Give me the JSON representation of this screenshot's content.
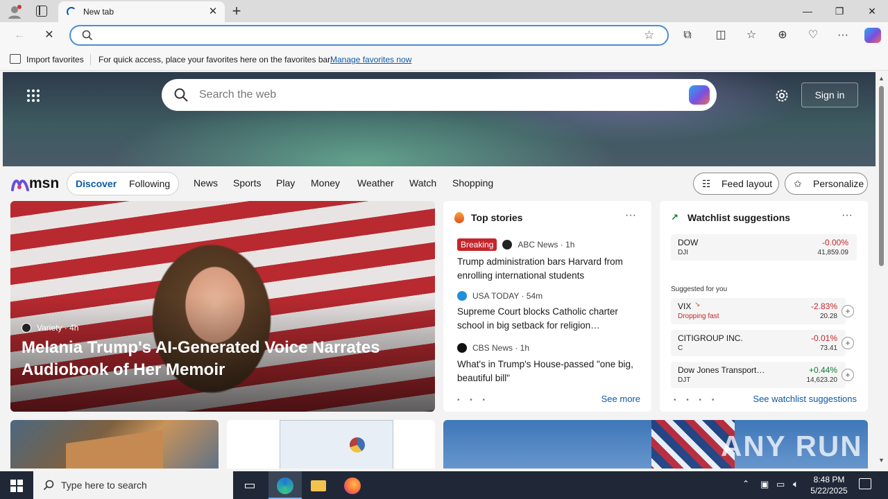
{
  "browser": {
    "tab_title": "New tab",
    "tab_close": "✕",
    "new_tab": "+",
    "window": {
      "minimize": "—",
      "restore": "❐",
      "close": "✕"
    },
    "address_value": "",
    "favorites_bar": {
      "import_label": "Import favorites",
      "hint": "For quick access, place your favorites here on the favorites bar.",
      "manage_link": "Manage favorites now"
    }
  },
  "msn": {
    "search_placeholder": "Search the web",
    "sign_in": "Sign in",
    "logo": "msn",
    "tabs": [
      "Discover",
      "Following"
    ],
    "nav": [
      "News",
      "Sports",
      "Play",
      "Money",
      "Weather",
      "Watch",
      "Shopping"
    ],
    "feed_layout": "Feed layout",
    "personalize": "Personalize"
  },
  "feature": {
    "source": "Variety · 4h",
    "title": "Melania Trump's AI-Generated Voice Narrates Audiobook of Her Memoir"
  },
  "top_stories": {
    "title": "Top stories",
    "more": "···",
    "items": [
      {
        "badge": "Breaking",
        "source": "ABC News · 1h",
        "headline": "Trump administration bars Harvard from enrolling international students"
      },
      {
        "badge": "",
        "source": "USA TODAY · 54m",
        "headline": "Supreme Court blocks Catholic charter school in big setback for religion…"
      },
      {
        "badge": "",
        "source": "CBS News · 1h",
        "headline": "What's in Trump's House-passed \"one big, beautiful bill\""
      }
    ],
    "dots": "• • •",
    "see_more": "See more"
  },
  "watchlist": {
    "title": "Watchlist suggestions",
    "more": "···",
    "primary": {
      "name": "DOW",
      "symbol": "DJI",
      "change": "-0.00%",
      "price": "41,859.09"
    },
    "suggested_label": "Suggested for you",
    "suggested": [
      {
        "name": "VIX",
        "symbol": "Dropping fast",
        "change": "-2.83%",
        "price": "20.28",
        "up": false
      },
      {
        "name": "CITIGROUP INC.",
        "symbol": "C",
        "change": "-0.01%",
        "price": "73.41",
        "up": false
      },
      {
        "name": "Dow Jones Transport…",
        "symbol": "DJT",
        "change": "+0.44%",
        "price": "14,623.20",
        "up": true
      }
    ],
    "dots": "• • • •",
    "see_more": "See watchlist suggestions"
  },
  "watermark": "ANY RUN",
  "taskbar": {
    "search_placeholder": "Type here to search",
    "time": "8:48 PM",
    "date": "5/22/2025"
  },
  "colors": {
    "accent": "#0c59a4",
    "negative": "#c4252b",
    "positive": "#0f7b3a"
  }
}
